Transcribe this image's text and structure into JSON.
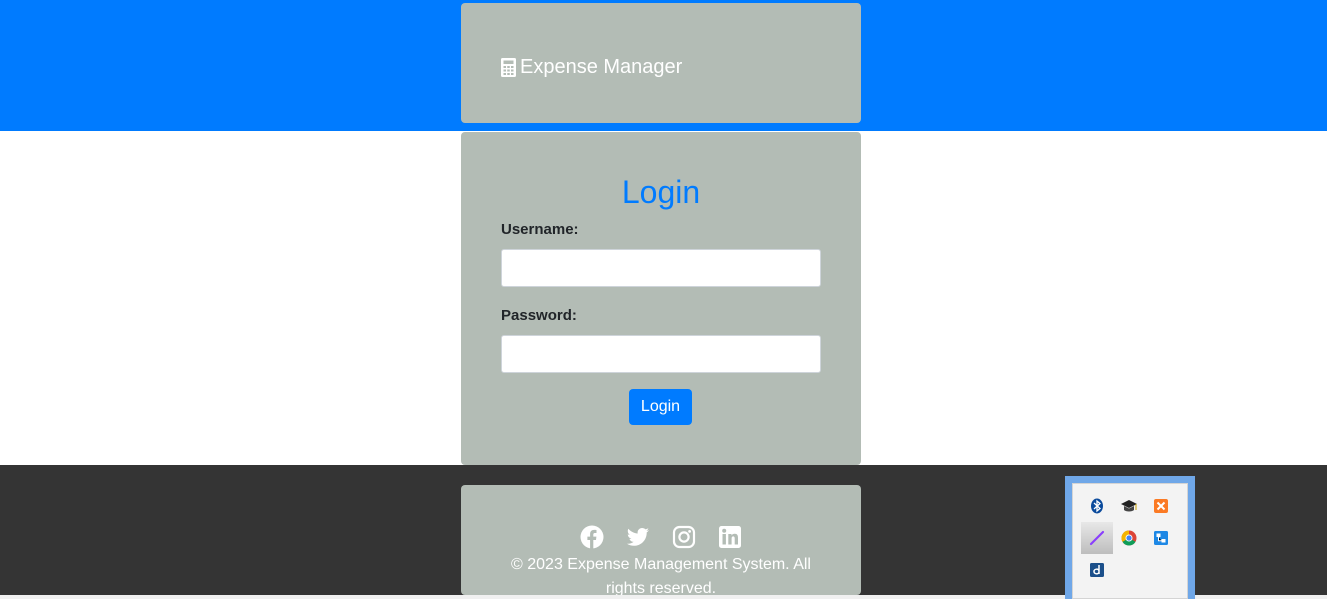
{
  "header": {
    "brand_label": "Expense Manager",
    "brand_icon": "calculator-icon"
  },
  "login": {
    "title": "Login",
    "username_label": "Username:",
    "username_value": "",
    "password_label": "Password:",
    "password_value": "",
    "submit_label": "Login"
  },
  "footer": {
    "social_icons": [
      "facebook-icon",
      "twitter-icon",
      "instagram-icon",
      "linkedin-icon"
    ],
    "copyright": "© 2023 Expense Management System. All rights reserved."
  },
  "system_tray": {
    "icons": [
      "bluetooth-icon",
      "graduation-cap-icon",
      "xampp-icon",
      "pen-icon",
      "chrome-icon",
      "network-icon",
      "d-app-icon"
    ]
  },
  "colors": {
    "primary": "#007bff",
    "card": "#b3bcb5",
    "footer_band": "#343434"
  }
}
